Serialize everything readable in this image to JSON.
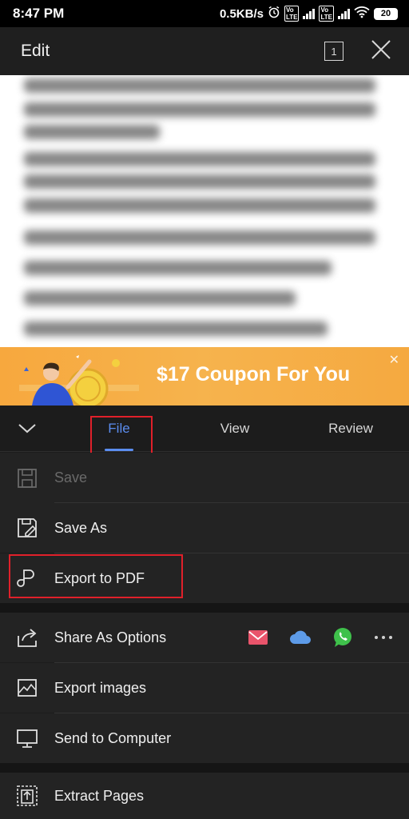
{
  "status": {
    "time": "8:47 PM",
    "speed": "0.5KB/s",
    "battery": "20"
  },
  "header": {
    "title": "Edit",
    "page_count": "1"
  },
  "banner": {
    "text": "$17 Coupon For You"
  },
  "tabs": [
    {
      "label": "File",
      "active": true
    },
    {
      "label": "View",
      "active": false
    },
    {
      "label": "Review",
      "active": false
    }
  ],
  "menu": {
    "save": "Save",
    "save_as": "Save As",
    "export_pdf": "Export to PDF",
    "share_options": "Share As Options",
    "export_images": "Export images",
    "send_computer": "Send to Computer",
    "extract_pages": "Extract Pages"
  },
  "share_targets": [
    "email-icon",
    "cloud-icon",
    "whatsapp-icon",
    "more-icon"
  ],
  "colors": {
    "accent": "#5b8def",
    "highlight": "#e0202a",
    "banner": "#f7a83e",
    "email": "#e9546b",
    "cloud": "#5d9be8",
    "whatsapp": "#3fc14b"
  }
}
